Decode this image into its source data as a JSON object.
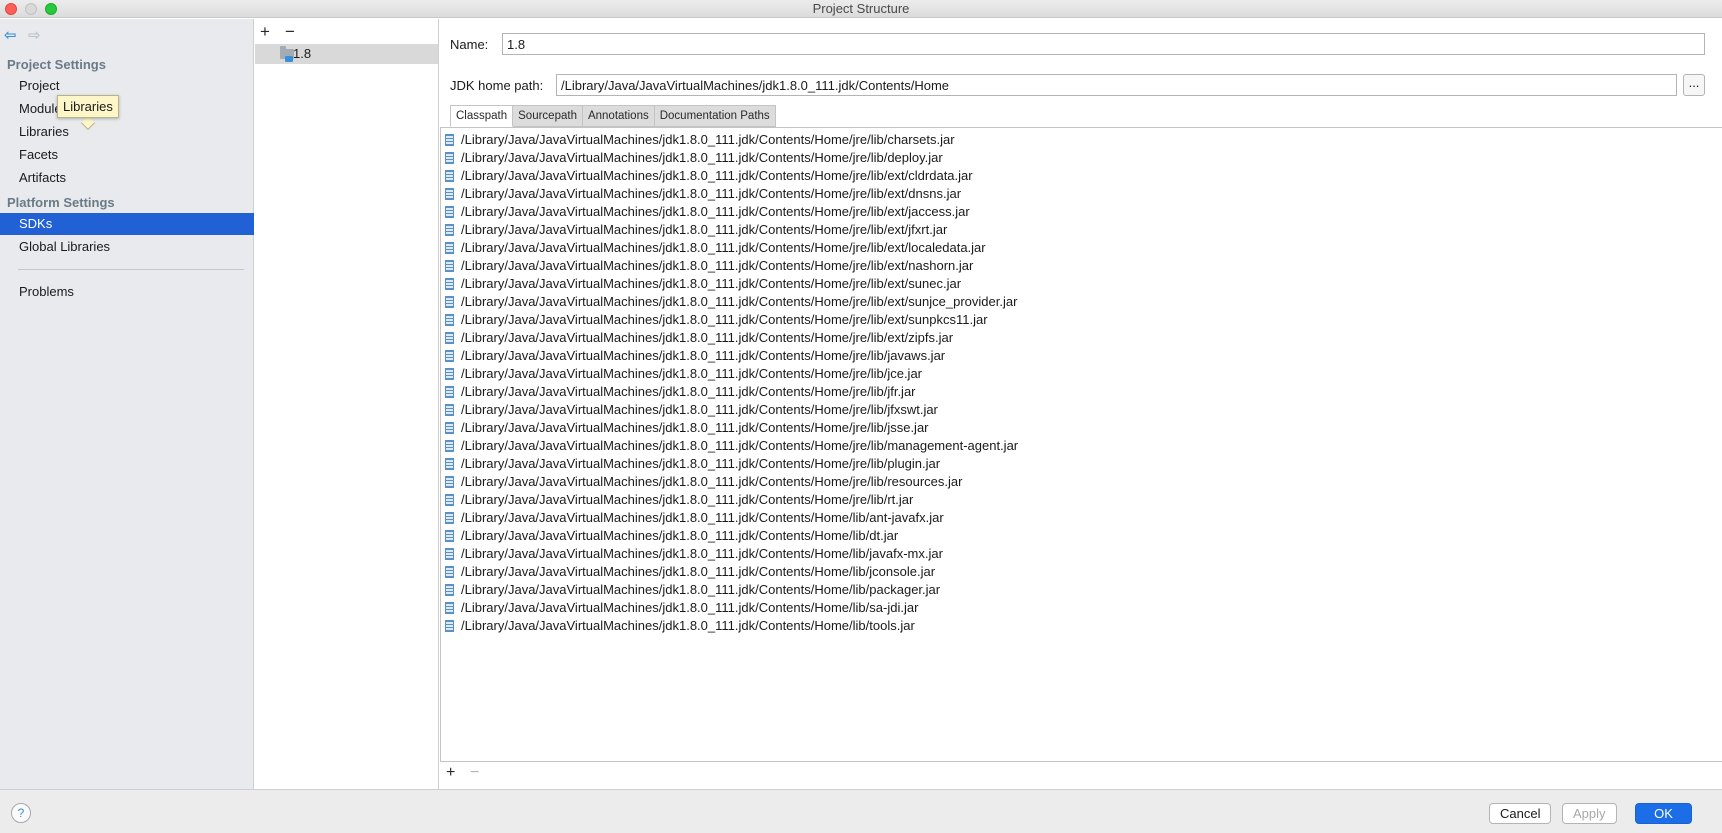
{
  "window": {
    "title": "Project Structure"
  },
  "sidebar": {
    "project_settings_title": "Project Settings",
    "project_items": [
      {
        "label": "Project"
      },
      {
        "label": "Modules"
      },
      {
        "label": "Libraries"
      },
      {
        "label": "Facets"
      },
      {
        "label": "Artifacts"
      }
    ],
    "platform_settings_title": "Platform Settings",
    "platform_items": [
      {
        "label": "SDKs",
        "selected": true
      },
      {
        "label": "Global Libraries"
      }
    ],
    "problems_label": "Problems",
    "tooltip": "Libraries"
  },
  "sdk_list": {
    "add_icon": "+",
    "remove_icon": "−",
    "items": [
      {
        "label": "1.8"
      }
    ]
  },
  "sdk_detail": {
    "name_label": "Name:",
    "name_value": "1.8",
    "jdk_home_label": "JDK home path:",
    "jdk_home_value": "/Library/Java/JavaVirtualMachines/jdk1.8.0_111.jdk/Contents/Home",
    "browse_label": "...",
    "tabs": [
      {
        "label": "Classpath",
        "active": true
      },
      {
        "label": "Sourcepath"
      },
      {
        "label": "Annotations"
      },
      {
        "label": "Documentation Paths"
      }
    ],
    "classpath": [
      "/Library/Java/JavaVirtualMachines/jdk1.8.0_111.jdk/Contents/Home/jre/lib/charsets.jar",
      "/Library/Java/JavaVirtualMachines/jdk1.8.0_111.jdk/Contents/Home/jre/lib/deploy.jar",
      "/Library/Java/JavaVirtualMachines/jdk1.8.0_111.jdk/Contents/Home/jre/lib/ext/cldrdata.jar",
      "/Library/Java/JavaVirtualMachines/jdk1.8.0_111.jdk/Contents/Home/jre/lib/ext/dnsns.jar",
      "/Library/Java/JavaVirtualMachines/jdk1.8.0_111.jdk/Contents/Home/jre/lib/ext/jaccess.jar",
      "/Library/Java/JavaVirtualMachines/jdk1.8.0_111.jdk/Contents/Home/jre/lib/ext/jfxrt.jar",
      "/Library/Java/JavaVirtualMachines/jdk1.8.0_111.jdk/Contents/Home/jre/lib/ext/localedata.jar",
      "/Library/Java/JavaVirtualMachines/jdk1.8.0_111.jdk/Contents/Home/jre/lib/ext/nashorn.jar",
      "/Library/Java/JavaVirtualMachines/jdk1.8.0_111.jdk/Contents/Home/jre/lib/ext/sunec.jar",
      "/Library/Java/JavaVirtualMachines/jdk1.8.0_111.jdk/Contents/Home/jre/lib/ext/sunjce_provider.jar",
      "/Library/Java/JavaVirtualMachines/jdk1.8.0_111.jdk/Contents/Home/jre/lib/ext/sunpkcs11.jar",
      "/Library/Java/JavaVirtualMachines/jdk1.8.0_111.jdk/Contents/Home/jre/lib/ext/zipfs.jar",
      "/Library/Java/JavaVirtualMachines/jdk1.8.0_111.jdk/Contents/Home/jre/lib/javaws.jar",
      "/Library/Java/JavaVirtualMachines/jdk1.8.0_111.jdk/Contents/Home/jre/lib/jce.jar",
      "/Library/Java/JavaVirtualMachines/jdk1.8.0_111.jdk/Contents/Home/jre/lib/jfr.jar",
      "/Library/Java/JavaVirtualMachines/jdk1.8.0_111.jdk/Contents/Home/jre/lib/jfxswt.jar",
      "/Library/Java/JavaVirtualMachines/jdk1.8.0_111.jdk/Contents/Home/jre/lib/jsse.jar",
      "/Library/Java/JavaVirtualMachines/jdk1.8.0_111.jdk/Contents/Home/jre/lib/management-agent.jar",
      "/Library/Java/JavaVirtualMachines/jdk1.8.0_111.jdk/Contents/Home/jre/lib/plugin.jar",
      "/Library/Java/JavaVirtualMachines/jdk1.8.0_111.jdk/Contents/Home/jre/lib/resources.jar",
      "/Library/Java/JavaVirtualMachines/jdk1.8.0_111.jdk/Contents/Home/jre/lib/rt.jar",
      "/Library/Java/JavaVirtualMachines/jdk1.8.0_111.jdk/Contents/Home/lib/ant-javafx.jar",
      "/Library/Java/JavaVirtualMachines/jdk1.8.0_111.jdk/Contents/Home/lib/dt.jar",
      "/Library/Java/JavaVirtualMachines/jdk1.8.0_111.jdk/Contents/Home/lib/javafx-mx.jar",
      "/Library/Java/JavaVirtualMachines/jdk1.8.0_111.jdk/Contents/Home/lib/jconsole.jar",
      "/Library/Java/JavaVirtualMachines/jdk1.8.0_111.jdk/Contents/Home/lib/packager.jar",
      "/Library/Java/JavaVirtualMachines/jdk1.8.0_111.jdk/Contents/Home/lib/sa-jdi.jar",
      "/Library/Java/JavaVirtualMachines/jdk1.8.0_111.jdk/Contents/Home/lib/tools.jar"
    ],
    "list_add_icon": "+",
    "list_remove_icon": "−"
  },
  "footer": {
    "help_label": "?",
    "cancel_label": "Cancel",
    "apply_label": "Apply",
    "ok_label": "OK"
  },
  "colors": {
    "selection": "#2260d6",
    "primary_button": "#1c6ee8",
    "sidebar_bg": "#e8eaed",
    "tooltip_bg": "#fcf6c8"
  }
}
